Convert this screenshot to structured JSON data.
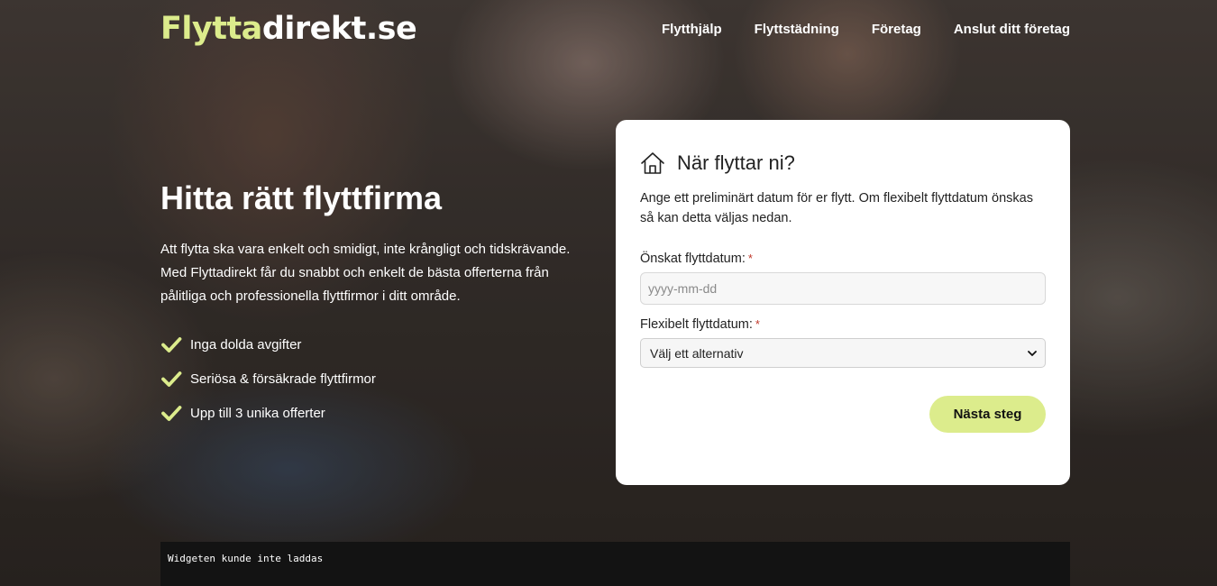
{
  "brand": {
    "logo_part1": "Flytta",
    "logo_part2": "direkt.se",
    "accent_color": "#dcec8c"
  },
  "nav": {
    "items": [
      {
        "label": "Flytthjälp"
      },
      {
        "label": "Flyttstädning"
      },
      {
        "label": "Företag"
      },
      {
        "label": "Anslut ditt företag"
      }
    ]
  },
  "hero": {
    "headline": "Hitta rätt flyttfirma",
    "intro": "Att flytta ska vara enkelt och smidigt, inte krångligt och tidskrävande. Med Flyttadirekt får du snabbt och enkelt de bästa offerterna från pålitliga och professionella flyttfirmor i ditt område.",
    "benefits": [
      {
        "label": "Inga dolda avgifter",
        "icon": "check-icon"
      },
      {
        "label": "Seriösa & försäkrade flyttfirmor",
        "icon": "check-icon"
      },
      {
        "label": "Upp till 3 unika offerter",
        "icon": "check-icon"
      }
    ]
  },
  "form": {
    "icon": "house-icon",
    "title": "När flyttar ni?",
    "description": "Ange ett preliminärt datum för er flytt. Om flexibelt flyttdatum önskas så kan detta väljas nedan.",
    "date_label": "Önskat flyttdatum:",
    "date_placeholder": "yyyy-mm-dd",
    "date_value": "",
    "flex_label": "Flexibelt flyttdatum:",
    "flex_selected": "Välj ett alternativ",
    "required_mark": "*",
    "next_label": "Nästa steg"
  },
  "widget_error": {
    "message": "Widgeten kunde inte laddas"
  }
}
